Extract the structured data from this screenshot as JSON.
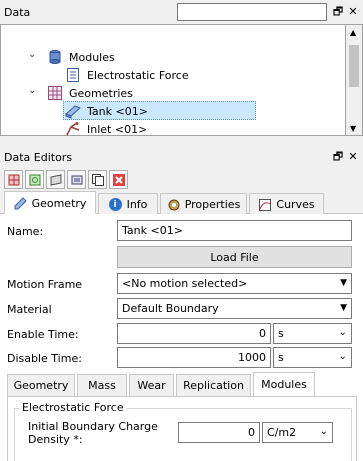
{
  "data_panel": {
    "title": "Data",
    "search_value": "",
    "float_glyph": "🗗",
    "close_glyph": "✕",
    "tree": [
      {
        "label": "Modules",
        "icon": "database-icon",
        "expanded": true
      },
      {
        "label": "Electrostatic Force",
        "icon": "document-icon"
      },
      {
        "label": "Geometries",
        "icon": "grid-icon",
        "expanded": true
      },
      {
        "label": "Tank <01>",
        "icon": "tank-geometry-icon",
        "selected": true
      },
      {
        "label": "Inlet <01>",
        "icon": "inlet-geometry-icon"
      }
    ]
  },
  "editors_panel": {
    "title": "Data Editors",
    "tabs": [
      {
        "label": "Geometry",
        "icon": "pencil-icon",
        "active": true
      },
      {
        "label": "Info",
        "icon": "info-icon"
      },
      {
        "label": "Properties",
        "icon": "properties-icon"
      },
      {
        "label": "Curves",
        "icon": "curves-icon"
      }
    ],
    "fields": {
      "name_label": "Name:",
      "name_value": "Tank <01>",
      "load_file_label": "Load File",
      "motion_label": "Motion Frame",
      "motion_value": "<No motion selected>",
      "material_label": "Material",
      "material_value": "Default Boundary",
      "enable_label": "Enable Time:",
      "enable_value": "0",
      "enable_unit": "s",
      "disable_label": "Disable Time:",
      "disable_value": "1000",
      "disable_unit": "s"
    },
    "subtabs": [
      "Geometry",
      "Mass",
      "Wear",
      "Replication",
      "Modules"
    ],
    "active_subtab": "Modules",
    "module": {
      "group_title": "Electrostatic Force",
      "charge_label_line1": "Initial Boundary Charge",
      "charge_label_line2": "Density *:",
      "charge_value": "0",
      "charge_unit": "C/m2"
    }
  },
  "colors": {
    "selection": "#cce8ff",
    "selection_border": "#99c9ef",
    "close_red": "#d32f2f"
  }
}
